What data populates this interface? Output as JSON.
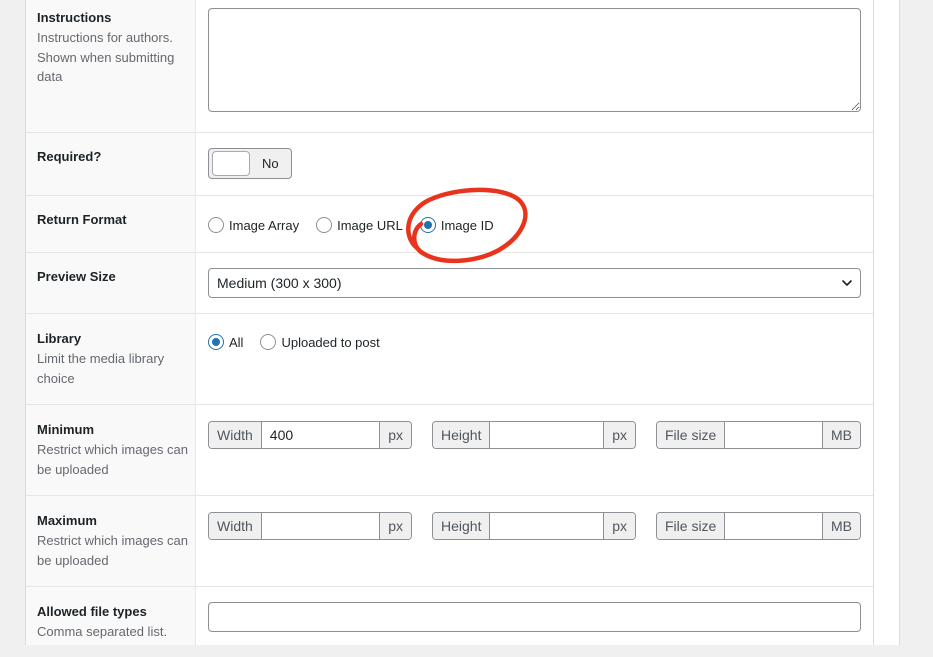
{
  "fields": {
    "instructions": {
      "title": "Instructions",
      "description": "Instructions for authors. Shown when submitting data",
      "value": ""
    },
    "required": {
      "title": "Required?",
      "toggle_label": "No"
    },
    "return_format": {
      "title": "Return Format",
      "options": [
        "Image Array",
        "Image URL",
        "Image ID"
      ],
      "selected": "Image ID"
    },
    "preview_size": {
      "title": "Preview Size",
      "selected": "Medium (300 x 300)"
    },
    "library": {
      "title": "Library",
      "description": "Limit the media library choice",
      "options": [
        "All",
        "Uploaded to post"
      ],
      "selected": "All"
    },
    "minimum": {
      "title": "Minimum",
      "description": "Restrict which images can be uploaded",
      "width_label": "Width",
      "width_value": "400",
      "width_unit": "px",
      "height_label": "Height",
      "height_value": "",
      "height_unit": "px",
      "filesize_label": "File size",
      "filesize_value": "",
      "filesize_unit": "MB"
    },
    "maximum": {
      "title": "Maximum",
      "description": "Restrict which images can be uploaded",
      "width_label": "Width",
      "width_value": "",
      "width_unit": "px",
      "height_label": "Height",
      "height_value": "",
      "height_unit": "px",
      "filesize_label": "File size",
      "filesize_value": "",
      "filesize_unit": "MB"
    },
    "allowed_types": {
      "title": "Allowed file types",
      "description": "Comma separated list.",
      "value": ""
    }
  },
  "colors": {
    "accent": "#2271b1",
    "annotation": "#e8341c",
    "border": "#8c8f94"
  }
}
